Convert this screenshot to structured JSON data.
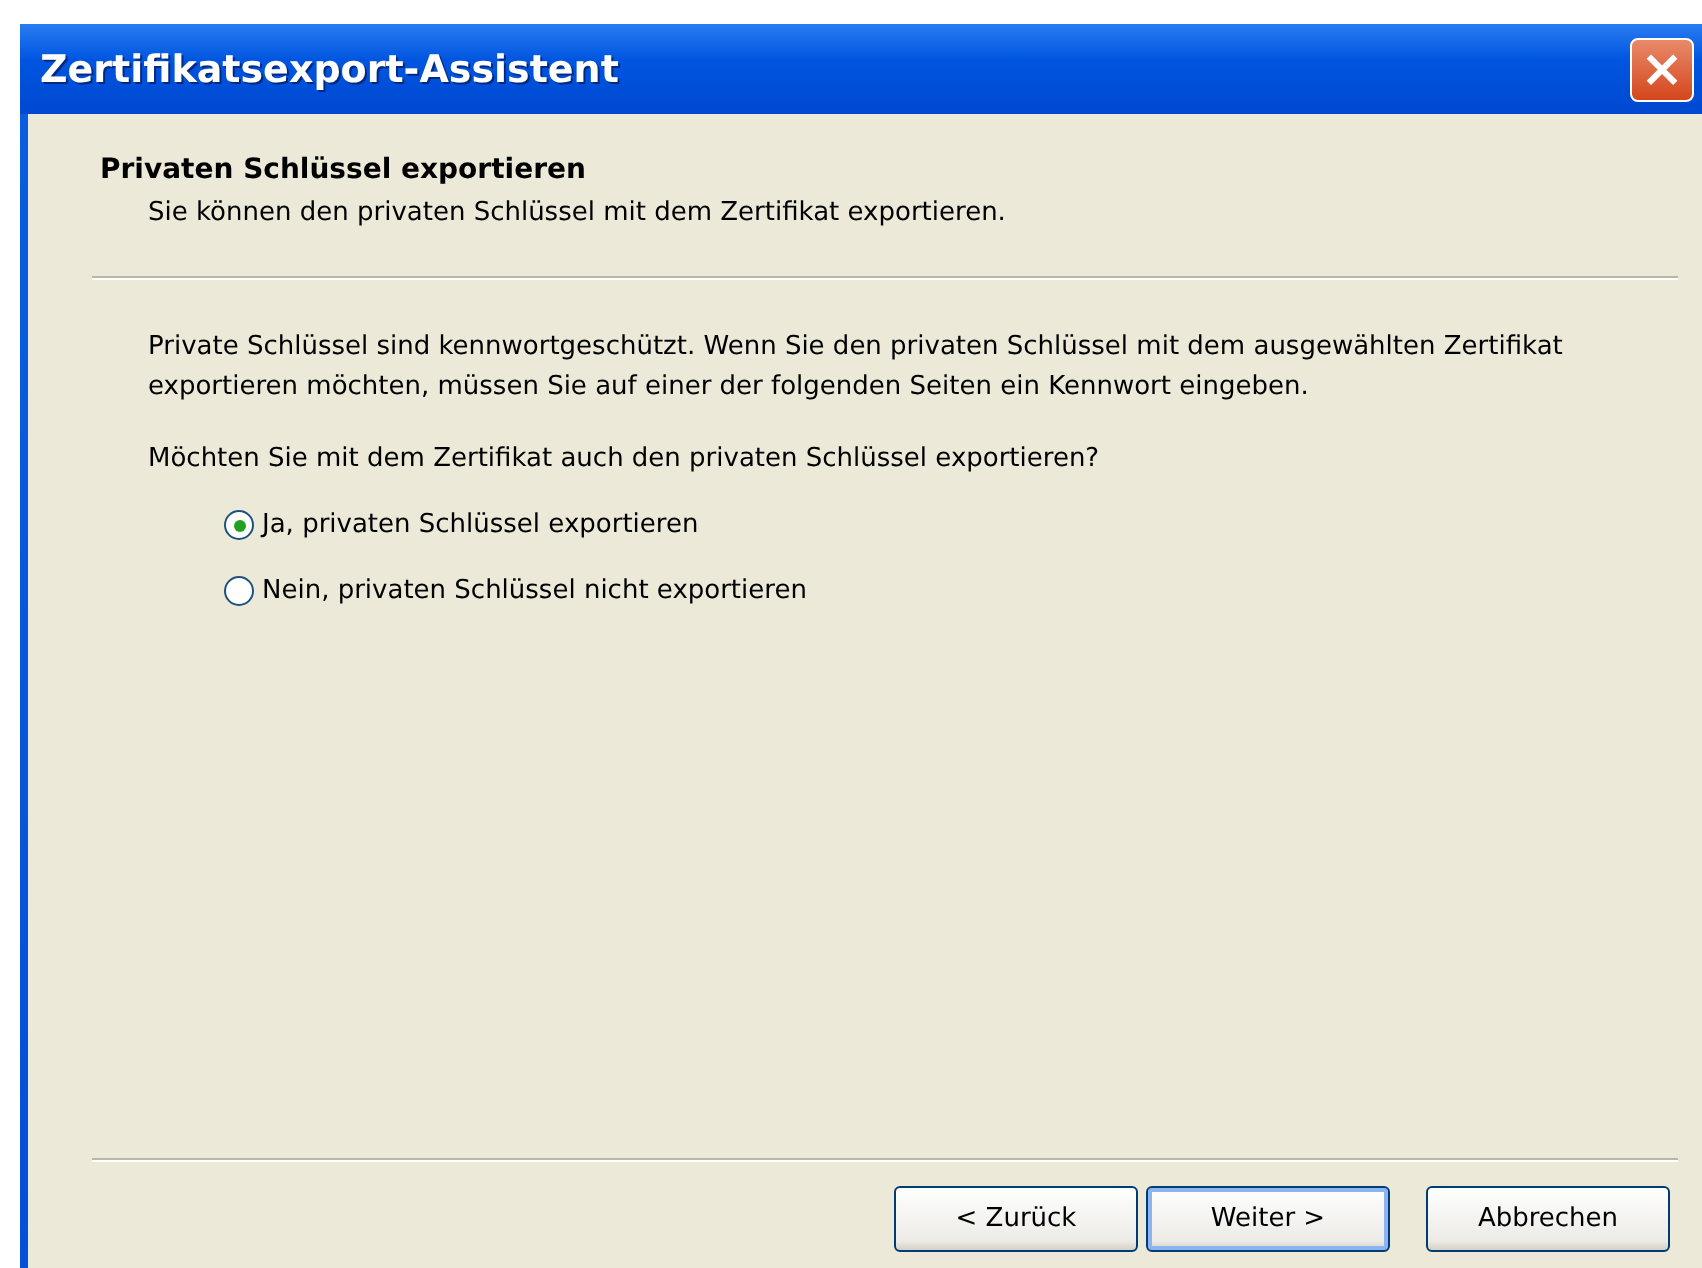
{
  "window": {
    "title": "Zertifikatsexport-Assistent",
    "close_button": "×"
  },
  "header": {
    "title": "Privaten Schlüssel exportieren",
    "subtitle": "Sie können den privaten Schlüssel mit dem Zertifikat exportieren."
  },
  "body": {
    "description": "Private Schlüssel sind kennwortgeschützt. Wenn Sie den privaten Schlüssel mit dem ausgewählten Zertifikat exportieren möchten, müssen Sie auf einer der folgenden Seiten ein Kennwort eingeben.",
    "question": "Möchten Sie mit dem Zertifikat auch den privaten Schlüssel exportieren?",
    "options": [
      {
        "label": "Ja, privaten Schlüssel exportieren",
        "selected": true
      },
      {
        "label": "Nein, privaten Schlüssel nicht exportieren",
        "selected": false
      }
    ]
  },
  "buttons": [
    {
      "label": "< Zurück",
      "default": false
    },
    {
      "label": "Weiter >",
      "default": true
    },
    {
      "label": "Abbrechen",
      "default": false
    }
  ]
}
